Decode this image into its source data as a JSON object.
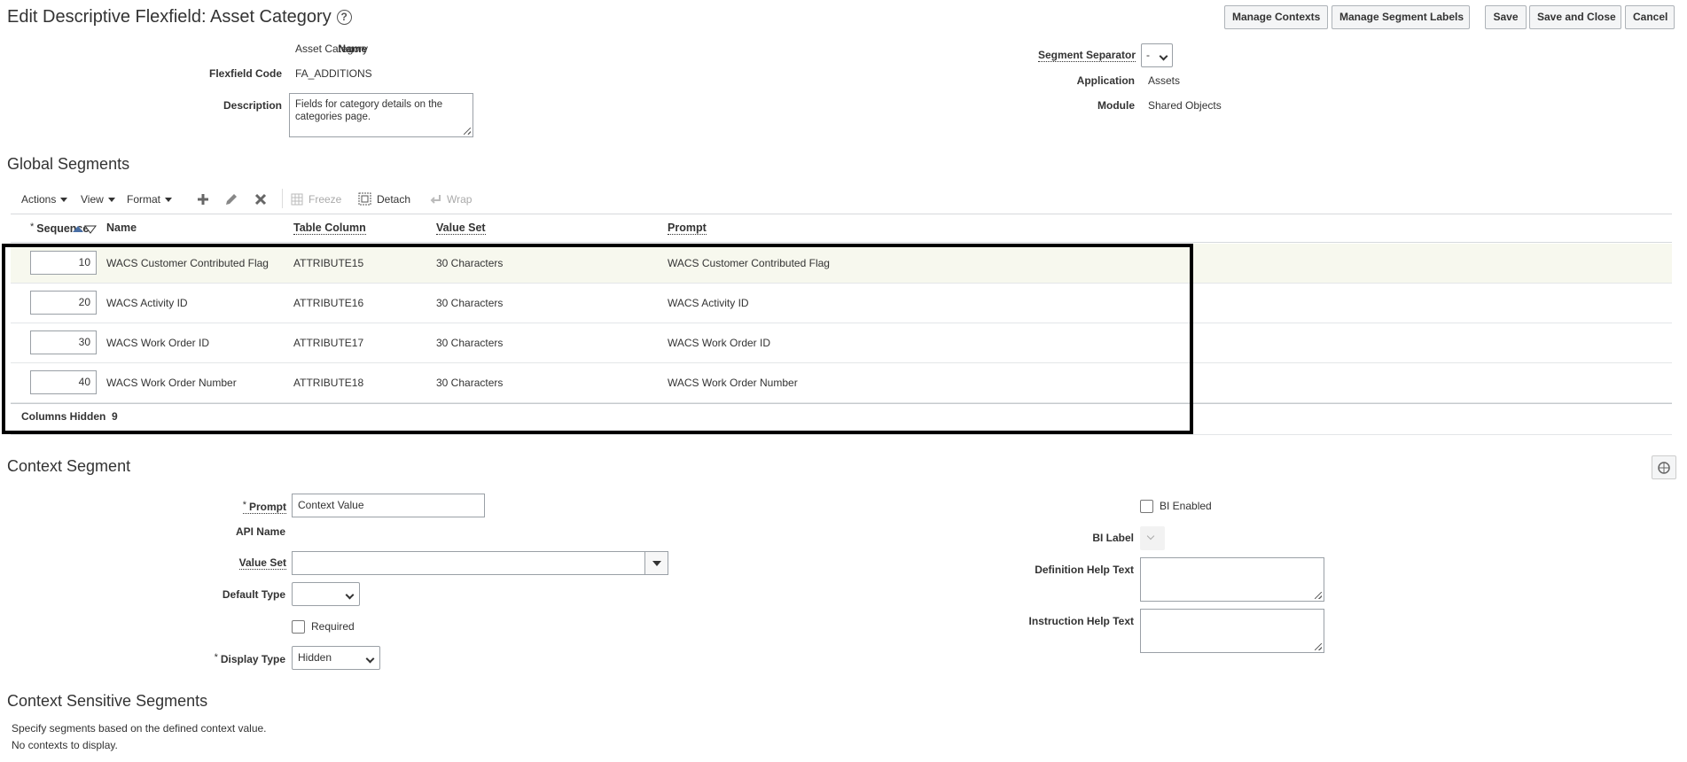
{
  "header": {
    "title": "Edit Descriptive Flexfield: Asset Category",
    "help_glyph": "?",
    "buttons": {
      "manage_contexts": "Manage Contexts",
      "manage_segment_labels": "Manage Segment Labels",
      "save": "Save",
      "save_and_close": "Save and Close",
      "cancel": "Cancel"
    }
  },
  "details": {
    "name_label": "Name",
    "name_value": "Asset Category",
    "flexfield_code_label": "Flexfield Code",
    "flexfield_code_value": "FA_ADDITIONS",
    "description_label": "Description",
    "description_value": "Fields for category details on the categories page.",
    "segment_separator_label": "Segment Separator",
    "segment_separator_value": "-",
    "application_label": "Application",
    "application_value": "Assets",
    "module_label": "Module",
    "module_value": "Shared Objects"
  },
  "global_segments": {
    "title": "Global Segments",
    "toolbar": {
      "actions": "Actions",
      "view": "View",
      "format": "Format",
      "freeze": "Freeze",
      "detach": "Detach",
      "wrap": "Wrap"
    },
    "columns": {
      "required_marker": "*",
      "sequence": "Sequence",
      "name": "Name",
      "table_column": "Table Column",
      "value_set": "Value Set",
      "prompt": "Prompt"
    },
    "rows": [
      {
        "sequence": "10",
        "name": "WACS Customer Contributed Flag",
        "table_column": "ATTRIBUTE15",
        "value_set": "30 Characters",
        "prompt": "WACS Customer Contributed Flag"
      },
      {
        "sequence": "20",
        "name": "WACS Activity ID",
        "table_column": "ATTRIBUTE16",
        "value_set": "30 Characters",
        "prompt": "WACS Activity ID"
      },
      {
        "sequence": "30",
        "name": "WACS Work Order ID",
        "table_column": "ATTRIBUTE17",
        "value_set": "30 Characters",
        "prompt": "WACS Work Order ID"
      },
      {
        "sequence": "40",
        "name": "WACS Work Order Number",
        "table_column": "ATTRIBUTE18",
        "value_set": "30 Characters",
        "prompt": "WACS Work Order Number"
      }
    ],
    "columns_hidden_label": "Columns Hidden",
    "columns_hidden_count": "9"
  },
  "context_segment": {
    "title": "Context Segment",
    "prompt_label": "Prompt",
    "prompt_value": "Context Value",
    "api_name_label": "API Name",
    "value_set_label": "Value Set",
    "value_set_value": "",
    "default_type_label": "Default Type",
    "default_type_value": "",
    "required_label": "Required",
    "display_type_label": "Display Type",
    "display_type_value": "Hidden",
    "bi_enabled_label": "BI Enabled",
    "bi_label_label": "BI Label",
    "definition_help_label": "Definition Help Text",
    "instruction_help_label": "Instruction Help Text"
  },
  "context_sensitive": {
    "title": "Context Sensitive Segments",
    "hint": "Specify segments based on the defined context value.",
    "empty": "No contexts to display."
  },
  "colors": {
    "selected_row": "#f7f8ee",
    "highlight_border": "#000000",
    "button_bg": "#f4f5f6"
  }
}
